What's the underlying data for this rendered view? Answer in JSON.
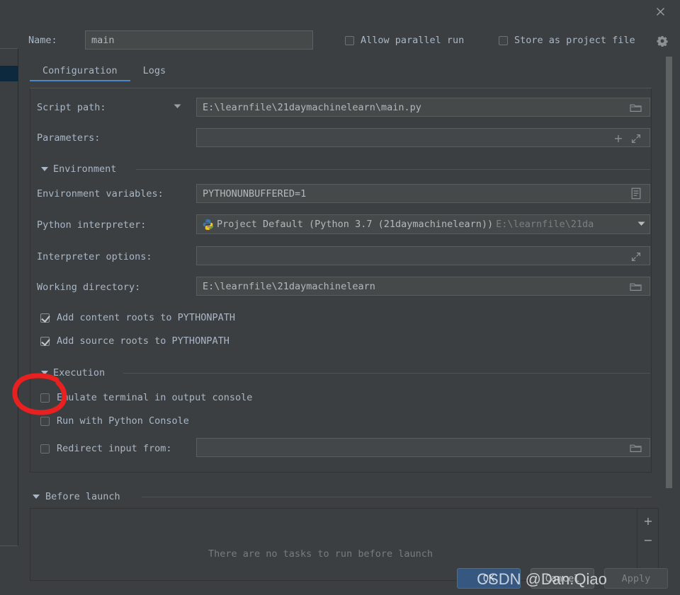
{
  "window": {
    "close_icon": "close-icon",
    "gear_icon": "gear-icon"
  },
  "name_row": {
    "label": "Name:",
    "value": "main",
    "placeholder": "",
    "allow_parallel_run": {
      "label": "Allow parallel run",
      "checked": false
    },
    "store_as_project_file": {
      "label": "Store as project file",
      "checked": false
    }
  },
  "tabs": [
    {
      "label": "Configuration",
      "active": true
    },
    {
      "label": "Logs",
      "active": false
    }
  ],
  "configuration": {
    "script_path": {
      "label": "Script path:",
      "value": "E:\\learnfile\\21daymachinelearn\\main.py",
      "icon": "folder-browse-icon",
      "has_label_dropdown": true
    },
    "parameters": {
      "label": "Parameters:",
      "value": "",
      "icons": [
        "insert-macro-icon",
        "expand-editor-icon"
      ]
    },
    "environment_group": {
      "title": "Environment",
      "expanded": true,
      "environment_variables": {
        "label": "Environment variables:",
        "value": "PYTHONUNBUFFERED=1",
        "icon": "edit-list-icon"
      },
      "python_interpreter": {
        "label": "Python interpreter:",
        "value": "Project Default (Python 3.7 (21daymachinelearn))",
        "secondary_value": "E:\\learnfile\\21da",
        "icon": "python-icon",
        "dropdown_icon": "chevron-down-icon"
      },
      "interpreter_options": {
        "label": "Interpreter options:",
        "value": "",
        "icon": "expand-editor-icon"
      },
      "working_directory": {
        "label": "Working directory:",
        "value": "E:\\learnfile\\21daymachinelearn",
        "icon": "folder-browse-icon"
      },
      "add_content_roots": {
        "label": "Add content roots to PYTHONPATH",
        "checked": true
      },
      "add_source_roots": {
        "label": "Add source roots to PYTHONPATH",
        "checked": true
      }
    },
    "execution_group": {
      "title": "Execution",
      "expanded": true,
      "emulate_terminal": {
        "label": "Emulate terminal in output console",
        "checked": false,
        "annotated": true
      },
      "run_with_python_console": {
        "label": "Run with Python Console",
        "checked": false
      },
      "redirect_input_from": {
        "label": "Redirect input from:",
        "checked": false,
        "value": "",
        "icon": "folder-browse-icon"
      }
    }
  },
  "before_launch": {
    "title": "Before launch",
    "expanded": true,
    "empty_message": "There are no tasks to run before launch",
    "add_button": "+",
    "remove_button": "−"
  },
  "footer": {
    "ok": "OK",
    "cancel": "Cancel",
    "apply": "Apply"
  },
  "watermark": {
    "text": "CSDN @Dan.Qiao"
  },
  "colors": {
    "panel_bg": "#3c3f41",
    "field_bg": "#45494a",
    "text": "#a9b7c6",
    "accent_tab": "#4a88c7",
    "ok_button": "#365880",
    "annotation_red": "#e8201f",
    "tree_selection": "#0d293e"
  }
}
